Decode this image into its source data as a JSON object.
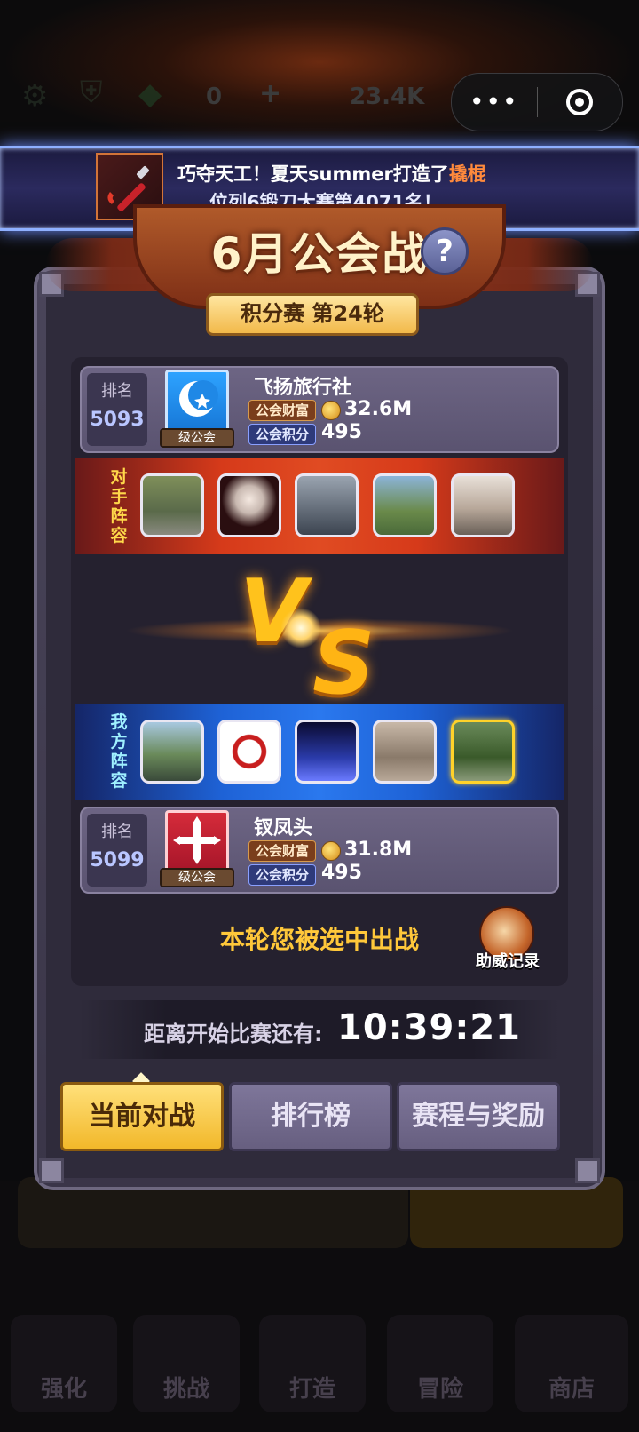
{
  "capsule": {
    "more_label": "•••",
    "close_icon": "target-icon"
  },
  "notification": {
    "line1_prefix": "巧夺天工！夏天summer打造了",
    "line1_item": "撬棍",
    "line2": "位列6锻刀大赛第4071名！",
    "item_icon": "crowbar-icon",
    "highlight_color": "#ff8a3c"
  },
  "event": {
    "title": "6月公会战",
    "help_label": "?",
    "round_label": "积分赛  第24轮"
  },
  "opponent": {
    "rank_label": "排名",
    "rank": "5093",
    "guild_level": "级公会",
    "guild_name": "飞扬旅行社",
    "wealth_label": "公会财富",
    "wealth_value": "32.6M",
    "points_label": "公会积分",
    "points_value": "495",
    "lineup_label": "对手阵容",
    "flag_color": "#2ea3ff",
    "flag_icon": "moon-star-icon"
  },
  "vs": {
    "v": "V",
    "s": "S"
  },
  "mine": {
    "lineup_label": "我方阵容",
    "rank_label": "排名",
    "rank": "5099",
    "guild_level": "级公会",
    "guild_name": "钗凤头",
    "wealth_label": "公会财富",
    "wealth_value": "31.8M",
    "points_label": "公会积分",
    "points_value": "495",
    "flag_color": "#d52b3a",
    "flag_icon": "cross-icon"
  },
  "battle": {
    "selected_text": "本轮您被选中出战",
    "record_label": "助威记录"
  },
  "timer": {
    "label": "距离开始比赛还有:",
    "value": "10:39:21"
  },
  "tabs": [
    {
      "label": "当前对战",
      "active": true
    },
    {
      "label": "排行榜",
      "active": false
    },
    {
      "label": "赛程与奖励",
      "active": false
    }
  ],
  "background_nav": [
    {
      "label": "强化"
    },
    {
      "label": "挑战"
    },
    {
      "label": "打造"
    },
    {
      "label": "冒险"
    },
    {
      "label": "商店"
    }
  ],
  "background_hud": {
    "gems": "0",
    "coins": "23.4K"
  }
}
